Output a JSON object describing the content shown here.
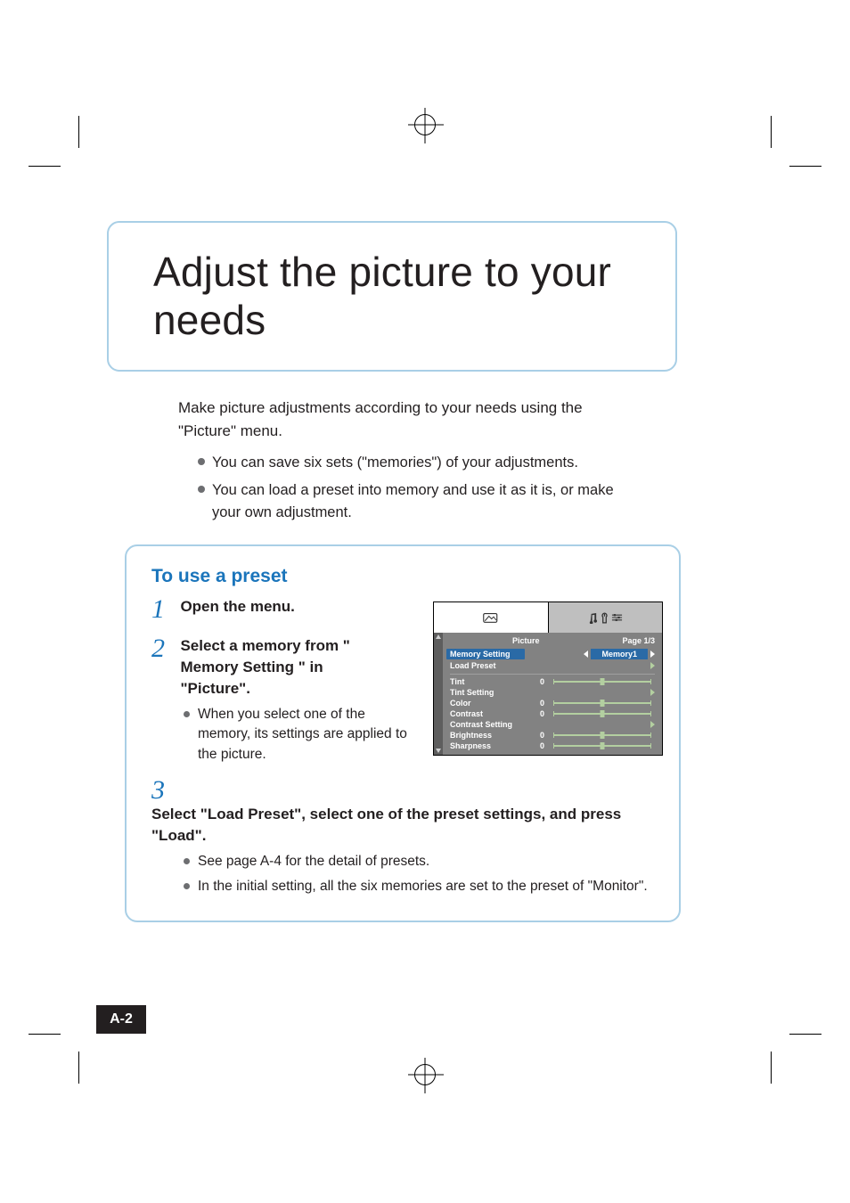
{
  "title": "Adjust the picture to your needs",
  "intro_text": "Make picture adjustments according to your needs using the \"Picture\" menu.",
  "intro_bullets": [
    "You can save six sets (\"memories\") of your adjustments.",
    "You can load a preset into memory and use it as it is, or make your own adjustment."
  ],
  "preset": {
    "heading": "To use a preset",
    "steps": [
      {
        "num": "1",
        "head": "Open the menu."
      },
      {
        "num": "2",
        "head": "Select a memory from \" Memory Setting \" in \"Picture\".",
        "notes": [
          "When you select one of the memory, its settings are applied to the picture."
        ]
      },
      {
        "num": "3",
        "head": "Select \"Load Preset\", select one of the preset settings, and press \"Load\".",
        "notes": [
          "See page A-4 for the detail of presets.",
          "In the initial setting, all the six memories are set to the preset of \"Monitor\"."
        ]
      }
    ]
  },
  "osd": {
    "tab_picture_label": "Picture",
    "page_indicator": "Page 1/3",
    "memory_setting_label": "Memory Setting",
    "memory_setting_value": "Memory1",
    "load_preset_label": "Load Preset",
    "rows": [
      {
        "label": "Tint",
        "value": "0",
        "slider": true
      },
      {
        "label": "Tint Setting",
        "value": "",
        "slider": false,
        "arrow": true
      },
      {
        "label": "Color",
        "value": "0",
        "slider": true
      },
      {
        "label": "Contrast",
        "value": "0",
        "slider": true
      },
      {
        "label": "Contrast Setting",
        "value": "",
        "slider": false,
        "arrow": true
      },
      {
        "label": "Brightness",
        "value": "0",
        "slider": true
      },
      {
        "label": "Sharpness",
        "value": "0",
        "slider": true
      }
    ]
  },
  "page_number": "A-2"
}
